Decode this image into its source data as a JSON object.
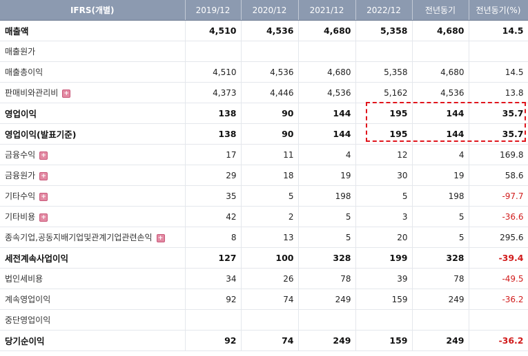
{
  "header": {
    "label_col": "IFRS(개별)",
    "columns": [
      "2019/12",
      "2020/12",
      "2021/12",
      "2022/12",
      "전년동기",
      "전년동기(%)"
    ]
  },
  "rows": [
    {
      "label": "매출액",
      "bold": true,
      "expand": false,
      "values": [
        "4,510",
        "4,536",
        "4,680",
        "5,358",
        "4,680",
        "14.5"
      ]
    },
    {
      "label": "매출원가",
      "bold": false,
      "expand": false,
      "values": [
        "",
        "",
        "",
        "",
        "",
        ""
      ]
    },
    {
      "label": "매출총이익",
      "bold": false,
      "expand": false,
      "values": [
        "4,510",
        "4,536",
        "4,680",
        "5,358",
        "4,680",
        "14.5"
      ]
    },
    {
      "label": "판매비와관리비",
      "bold": false,
      "expand": true,
      "values": [
        "4,373",
        "4,446",
        "4,536",
        "5,162",
        "4,536",
        "13.8"
      ]
    },
    {
      "label": "영업이익",
      "bold": true,
      "expand": false,
      "values": [
        "138",
        "90",
        "144",
        "195",
        "144",
        "35.7"
      ]
    },
    {
      "label": "영업이익(발표기준)",
      "bold": true,
      "expand": false,
      "values": [
        "138",
        "90",
        "144",
        "195",
        "144",
        "35.7"
      ]
    },
    {
      "label": "금융수익",
      "bold": false,
      "expand": true,
      "values": [
        "17",
        "11",
        "4",
        "12",
        "4",
        "169.8"
      ]
    },
    {
      "label": "금융원가",
      "bold": false,
      "expand": true,
      "values": [
        "29",
        "18",
        "19",
        "30",
        "19",
        "58.6"
      ]
    },
    {
      "label": "기타수익",
      "bold": false,
      "expand": true,
      "values": [
        "35",
        "5",
        "198",
        "5",
        "198",
        "-97.7"
      ]
    },
    {
      "label": "기타비용",
      "bold": false,
      "expand": true,
      "values": [
        "42",
        "2",
        "5",
        "3",
        "5",
        "-36.6"
      ]
    },
    {
      "label": "종속기업,공동지배기업및관계기업관련손익",
      "bold": false,
      "expand": true,
      "values": [
        "8",
        "13",
        "5",
        "20",
        "5",
        "295.6"
      ]
    },
    {
      "label": "세전계속사업이익",
      "bold": true,
      "expand": false,
      "values": [
        "127",
        "100",
        "328",
        "199",
        "328",
        "-39.4"
      ]
    },
    {
      "label": "법인세비용",
      "bold": false,
      "expand": false,
      "values": [
        "34",
        "26",
        "78",
        "39",
        "78",
        "-49.5"
      ]
    },
    {
      "label": "계속영업이익",
      "bold": false,
      "expand": false,
      "values": [
        "92",
        "74",
        "249",
        "159",
        "249",
        "-36.2"
      ]
    },
    {
      "label": "중단영업이익",
      "bold": false,
      "expand": false,
      "values": [
        "",
        "",
        "",
        "",
        "",
        ""
      ]
    },
    {
      "label": "당기순이익",
      "bold": true,
      "expand": false,
      "values": [
        "92",
        "74",
        "249",
        "159",
        "249",
        "-36.2"
      ]
    }
  ],
  "expand_icon": "plus-icon",
  "colors": {
    "header_bg": "#8c9ab0",
    "negative": "#d11b1b",
    "highlight": "#e0141b",
    "expand_icon": "#e38aa3"
  }
}
